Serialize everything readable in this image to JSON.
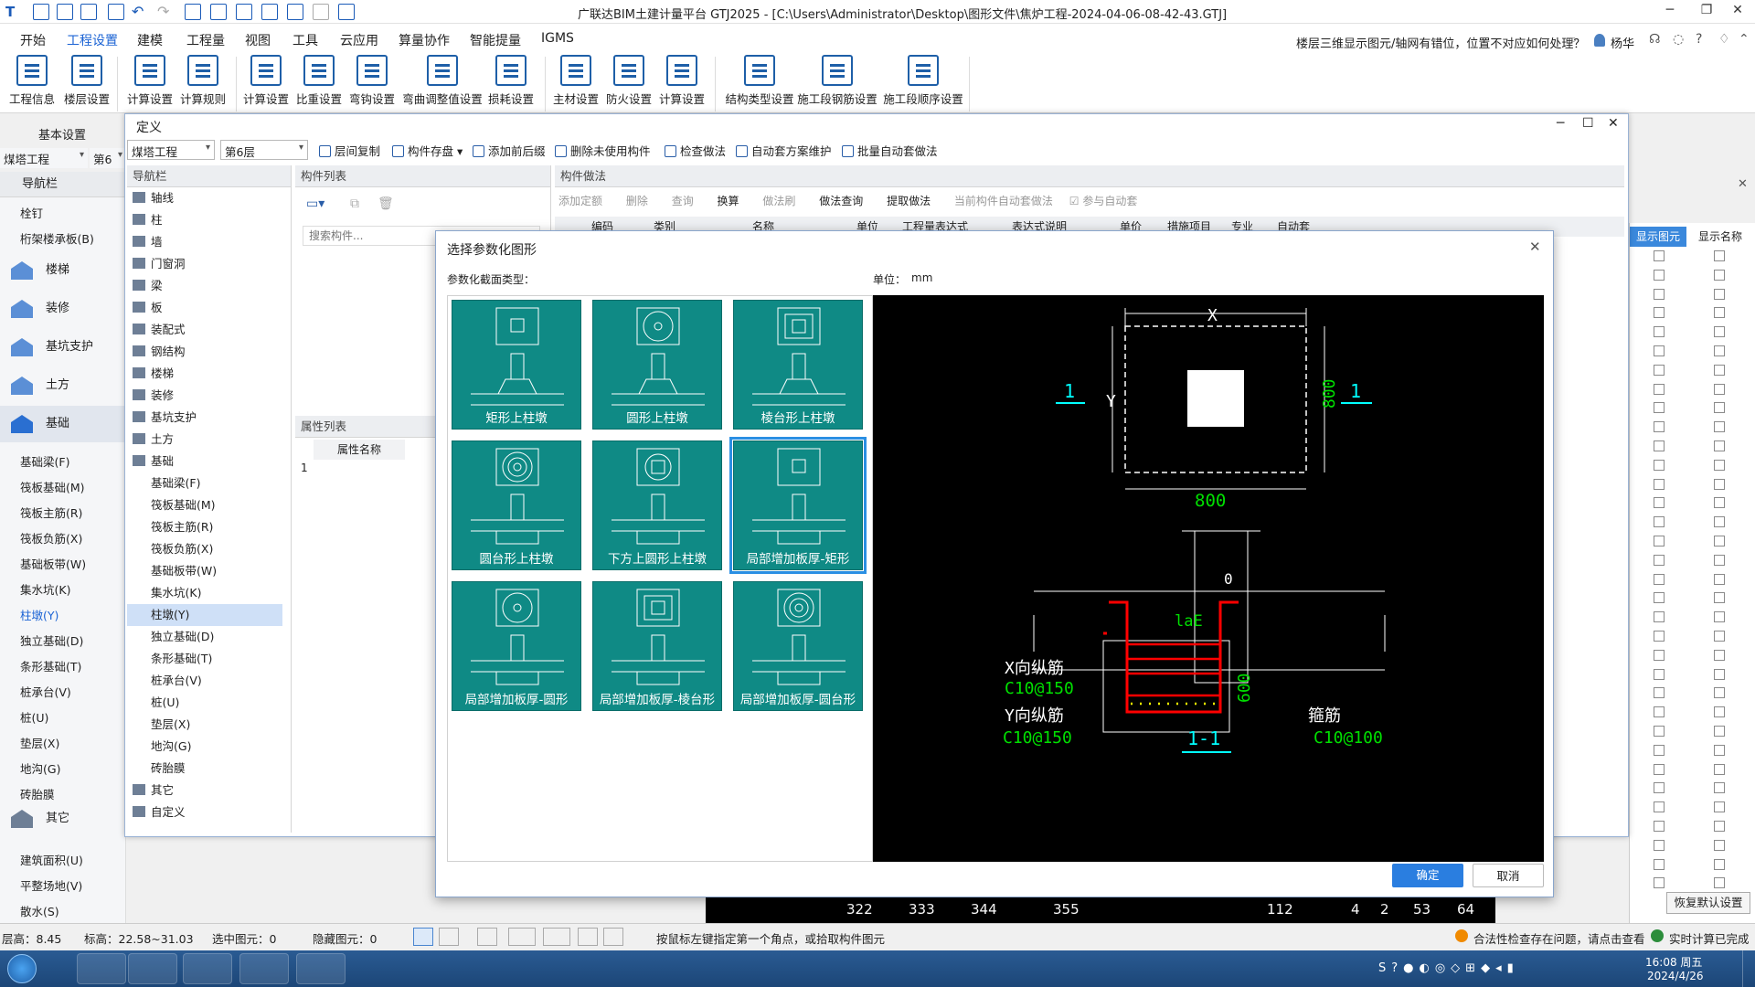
{
  "app": {
    "title": "广联达BIM土建计量平台 GTJ2025 - [C:\\Users\\Administrator\\Desktop\\图形文件\\焦炉工程-2024-04-06-08-42-43.GTJ]"
  },
  "menu": [
    "开始",
    "工程设置",
    "建模",
    "工程量",
    "视图",
    "工具",
    "云应用",
    "算量协作",
    "智能提量",
    "IGMS"
  ],
  "help_question": "楼层三维显示图元/轴网有错位，位置不对应如何处理？",
  "user": "杨华",
  "ribbon": {
    "group1": [
      {
        "label": "工程信息",
        "icon": "project-info-icon"
      },
      {
        "label": "楼层设置",
        "icon": "floor-setting-icon"
      }
    ],
    "group1_title": "基本设置",
    "group2": [
      {
        "label": "计算设置",
        "icon": "calc-setting-icon"
      },
      {
        "label": "计算规则",
        "icon": "calc-rule-icon"
      },
      {
        "label": "计算设置",
        "icon": "calc-setting2-icon"
      },
      {
        "label": "比重设置",
        "icon": "density-icon"
      },
      {
        "label": "弯钩设置",
        "icon": "hook-icon"
      },
      {
        "label": "弯曲调整值设置",
        "icon": "bend-icon"
      },
      {
        "label": "损耗设置",
        "icon": "loss-icon"
      }
    ],
    "group3": [
      {
        "label": "主材设置",
        "icon": "material-icon"
      },
      {
        "label": "防火设置",
        "icon": "fire-icon"
      },
      {
        "label": "计算设置",
        "icon": "calc-setting3-icon"
      }
    ],
    "group4": [
      {
        "label": "结构类型设置",
        "icon": "structure-icon"
      },
      {
        "label": "施工段钢筋设置",
        "icon": "segment-rebar-icon"
      },
      {
        "label": "施工段顺序设置",
        "icon": "segment-order-icon"
      }
    ]
  },
  "leftpanel": {
    "project_select": "煤塔工程",
    "floor_select": "第6层",
    "nav_title": "导航栏",
    "items_top": [
      "栓钉",
      "桁架楼承板(B)"
    ],
    "categories": [
      "楼梯",
      "装修",
      "基坑支护",
      "土方",
      "基础"
    ],
    "items": [
      "基础梁(F)",
      "筏板基础(M)",
      "筏板主筋(R)",
      "筏板负筋(X)",
      "基础板带(W)",
      "集水坑(K)",
      "柱墩(Y)",
      "独立基础(D)",
      "条形基础(T)",
      "桩承台(V)",
      "桩(U)",
      "垫层(X)",
      "地沟(G)",
      "砖胎膜"
    ],
    "category_other": "其它",
    "items_bottom": [
      "建筑面积(U)",
      "平整场地(V)",
      "散水(S)"
    ]
  },
  "defwin": {
    "title": "定义",
    "project": "煤塔工程",
    "floor": "第6层",
    "toolbar": [
      "层间复制",
      "构件存盘",
      "添加前后缀",
      "删除未使用构件",
      "检查做法",
      "自动套方案维护",
      "批量自动套做法"
    ],
    "nav_head": "导航栏",
    "nav": [
      {
        "label": "轴线",
        "sub": false
      },
      {
        "label": "柱",
        "sub": false
      },
      {
        "label": "墙",
        "sub": false
      },
      {
        "label": "门窗洞",
        "sub": false
      },
      {
        "label": "梁",
        "sub": false
      },
      {
        "label": "板",
        "sub": false
      },
      {
        "label": "装配式",
        "sub": false
      },
      {
        "label": "钢结构",
        "sub": false
      },
      {
        "label": "楼梯",
        "sub": false
      },
      {
        "label": "装修",
        "sub": false
      },
      {
        "label": "基坑支护",
        "sub": false
      },
      {
        "label": "土方",
        "sub": false
      },
      {
        "label": "基础",
        "sub": false
      },
      {
        "label": "基础梁(F)",
        "sub": true
      },
      {
        "label": "筏板基础(M)",
        "sub": true
      },
      {
        "label": "筏板主筋(R)",
        "sub": true
      },
      {
        "label": "筏板负筋(X)",
        "sub": true
      },
      {
        "label": "基础板带(W)",
        "sub": true
      },
      {
        "label": "集水坑(K)",
        "sub": true
      },
      {
        "label": "柱墩(Y)",
        "sub": true
      },
      {
        "label": "独立基础(D)",
        "sub": true
      },
      {
        "label": "条形基础(T)",
        "sub": true
      },
      {
        "label": "桩承台(V)",
        "sub": true
      },
      {
        "label": "桩(U)",
        "sub": true
      },
      {
        "label": "垫层(X)",
        "sub": true
      },
      {
        "label": "地沟(G)",
        "sub": true
      },
      {
        "label": "砖胎膜",
        "sub": true
      },
      {
        "label": "其它",
        "sub": false
      },
      {
        "label": "自定义",
        "sub": false
      }
    ],
    "comp_list_head": "构件列表",
    "search_placeholder": "搜索构件...",
    "attr_head": "属性列表",
    "attr_col": "属性名称",
    "attr_row": "1",
    "method_head": "构件做法",
    "method_toolbar": [
      "添加定额",
      "删除",
      "查询",
      "换算",
      "做法刷",
      "做法查询",
      "提取做法",
      "当前构件自动套做法",
      "参与自动套"
    ],
    "method_cols": [
      "编码",
      "类别",
      "名称",
      "单位",
      "工程量表达式",
      "表达式说明",
      "单价",
      "措施项目",
      "专业",
      "自动套"
    ]
  },
  "dialog": {
    "title": "选择参数化图形",
    "type_label": "参数化截面类型：",
    "unit_label": "单位：",
    "unit": "mm",
    "tiles": [
      "矩形上柱墩",
      "圆形上柱墩",
      "棱台形上柱墩",
      "圆台形上柱墩",
      "下方上圆形上柱墩",
      "局部增加板厚-矩形",
      "局部增加板厚-圆形",
      "局部增加板厚-棱台形",
      "局部增加板厚-圆台形"
    ],
    "selected": "局部增加板厚-矩形",
    "ok": "确定",
    "cancel": "取消",
    "drawing": {
      "x": "X",
      "y": "Y",
      "dim_h": "800",
      "dim_v": "800",
      "sec_left": "1",
      "sec_right": "1",
      "zero": "0",
      "lae": "laE",
      "dim_600": "600",
      "x_bar": "X向纵筋",
      "x_bar_spec": "C10@150",
      "y_bar": "Y向纵筋",
      "y_bar_spec": "C10@150",
      "stirrup": "箍筋",
      "stirrup_spec": "C10@100",
      "section_title": "1-1"
    }
  },
  "rightcol": {
    "show_elem": "显示图元",
    "show_name": "显示名称",
    "restore": "恢复默认设置"
  },
  "status": {
    "floor_h": "层高：8.45",
    "elev": "标高：22.58~31.03",
    "selected": "选中图元：0",
    "hidden": "隐藏图元：0",
    "hint": "按鼠标左键指定第一个角点，或拾取构件图元",
    "check": "合法性检查存在问题，请点击查看",
    "realtime": "实时计算已完成"
  },
  "bottom_axis": [
    "322",
    "333",
    "344",
    "355",
    "112",
    "4",
    "2",
    "53",
    "64"
  ],
  "clock": {
    "time": "16:08 周五",
    "date": "2024/4/26"
  },
  "colors": {
    "teal": "#0f8a85",
    "accent": "#1b63d4",
    "cad_bg": "#000000"
  }
}
